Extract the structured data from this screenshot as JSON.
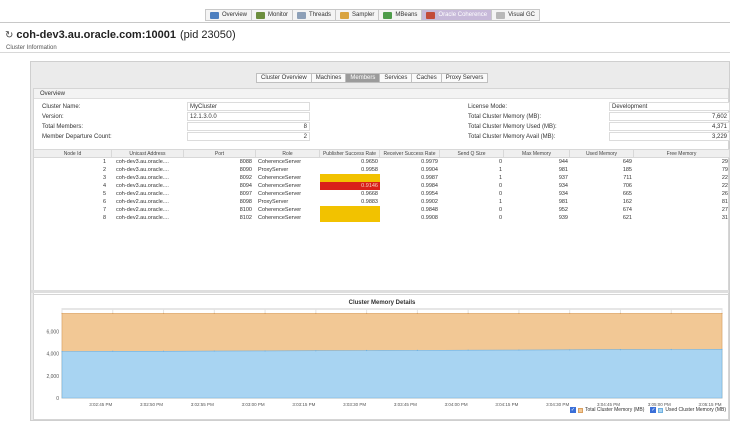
{
  "toolbar": {
    "tabs": [
      {
        "label": "Overview",
        "icon": "overview-icon",
        "color": "#4d7fbf",
        "active": false
      },
      {
        "label": "Monitor",
        "icon": "monitor-icon",
        "color": "#6c8e3e",
        "active": false
      },
      {
        "label": "Threads",
        "icon": "threads-icon",
        "color": "#8da0b8",
        "active": false
      },
      {
        "label": "Sampler",
        "icon": "sampler-icon",
        "color": "#d9a441",
        "active": false
      },
      {
        "label": "MBeans",
        "icon": "mbeans-icon",
        "color": "#4e9c4a",
        "active": false
      },
      {
        "label": "Oracle Coherence",
        "icon": "coherence-icon",
        "color": "#c24a3a",
        "active": true
      },
      {
        "label": "Visual GC",
        "icon": "visualgc-icon",
        "color": "#b8b8b8",
        "active": false
      }
    ]
  },
  "app": {
    "host": "coh-dev3.au.oracle.com:10001",
    "pid": "(pid 23050)",
    "subtitle": "Cluster Information"
  },
  "subtabs": [
    {
      "label": "Cluster Overview",
      "active": false
    },
    {
      "label": "Machines",
      "active": false
    },
    {
      "label": "Members",
      "active": true
    },
    {
      "label": "Services",
      "active": false
    },
    {
      "label": "Caches",
      "active": false
    },
    {
      "label": "Proxy Servers",
      "active": false
    }
  ],
  "overview": {
    "heading": "Overview",
    "cluster_name_label": "Cluster Name:",
    "cluster_name": "MyCluster",
    "version_label": "Version:",
    "version": "12.1.3.0.0",
    "total_members_label": "Total Members:",
    "total_members": "8",
    "departure_label": "Member Departure Count:",
    "departure_count": "2",
    "license_label": "License Mode:",
    "license": "Development",
    "mem_label": "Total Cluster Memory (MB):",
    "mem": "7,602",
    "mem_used_label": "Total Cluster Memory Used (MB):",
    "mem_used": "4,371",
    "mem_avail_label": "Total Cluster Memory Avail (MB):",
    "mem_avail": "3,229"
  },
  "members": {
    "columns": [
      "Node Id",
      "Unicast Address",
      "Port",
      "Role",
      "Publisher Success Rate",
      "Receiver Success Rate",
      "Send Q Size",
      "Max Memory",
      "Used Memory",
      "Free Memory"
    ],
    "rows": [
      [
        "1",
        "coh-dev3.au.oracle....",
        "8088",
        "CoherenceServer",
        "0.9650",
        "0.9979",
        "0",
        "944",
        "649",
        "29"
      ],
      [
        "2",
        "coh-dev3.au.oracle....",
        "8090",
        "ProxyServer",
        "0.9958",
        "0.9904",
        "1",
        "981",
        "185",
        "79"
      ],
      [
        "3",
        "coh-dev3.au.oracle....",
        "8092",
        "CoherenceServer",
        "0.9215",
        "0.9987",
        "1",
        "937",
        "711",
        "22"
      ],
      [
        "4",
        "coh-dev3.au.oracle....",
        "8094",
        "CoherenceServer",
        "0.9146",
        "0.9984",
        "0",
        "934",
        "706",
        "22"
      ],
      [
        "5",
        "coh-dev2.au.oracle....",
        "8097",
        "CoherenceServer",
        "0.9668",
        "0.9954",
        "0",
        "934",
        "665",
        "26"
      ],
      [
        "6",
        "coh-dev2.au.oracle....",
        "8098",
        "ProxyServer",
        "0.9883",
        "0.9902",
        "1",
        "981",
        "162",
        "81"
      ],
      [
        "7",
        "coh-dev2.au.oracle....",
        "8100",
        "CoherenceServer",
        "0.9285",
        "0.9848",
        "0",
        "952",
        "674",
        "27"
      ],
      [
        "8",
        "coh-dev2.au.oracle....",
        "8102",
        "CoherenceServer",
        "0.9257",
        "0.9908",
        "0",
        "939",
        "621",
        "31"
      ]
    ],
    "row_status": [
      "",
      "",
      "warn",
      "crit",
      "",
      "",
      "warn",
      "warn"
    ],
    "colors": {
      "warn": "#f2c200",
      "crit": "#d9201a"
    }
  },
  "chart_data": {
    "type": "area",
    "title": "Cluster Memory Details",
    "x": [
      "3:02:30 PM",
      "3:02:45 PM",
      "3:02:50 PM",
      "3:02:55 PM",
      "3:03:00 PM",
      "3:03:15 PM",
      "3:03:30 PM",
      "3:03:45 PM",
      "3:04:00 PM",
      "3:04:15 PM",
      "3:04:30 PM",
      "3:04:45 PM",
      "3:05:00 PM",
      "3:05:15 PM"
    ],
    "ylim": [
      0,
      8000
    ],
    "yticks": [
      "0",
      "2,000",
      "4,000",
      "6,000"
    ],
    "ytick_values": [
      0,
      2000,
      4000,
      6000
    ],
    "grid": true,
    "series": [
      {
        "name": "Total Cluster Memory (MB)",
        "color": "#f2c895",
        "values": [
          7602,
          7602,
          7602,
          7602,
          7602,
          7602,
          7602,
          7602,
          7602,
          7602,
          7602,
          7602,
          7602,
          7602
        ]
      },
      {
        "name": "Used Cluster Memory (MB)",
        "color": "#a8d4f2",
        "values": [
          4180,
          4200,
          4200,
          4220,
          4230,
          4250,
          4270,
          4280,
          4300,
          4310,
          4330,
          4350,
          4360,
          4371
        ]
      }
    ],
    "legend_position": "bottom-right"
  }
}
